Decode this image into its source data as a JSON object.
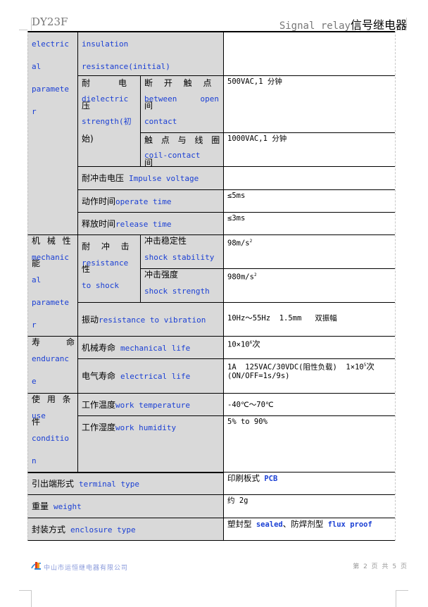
{
  "header": {
    "model": "DY23F",
    "title_en": "Signal relay",
    "title_zh": "信号继电器"
  },
  "table": {
    "electrical": {
      "group_label": [
        "electric",
        "al",
        "paramete",
        "r"
      ],
      "insulation": {
        "label": [
          "insulation",
          "resistance(initial)"
        ],
        "value": ""
      },
      "dielectric": {
        "label_zh": "耐　电　压",
        "label_en": [
          "dielectric",
          "strength(初",
          "始)"
        ],
        "open_contact": {
          "label_zh": "断 开 触 点 间",
          "label_en": [
            "between",
            "open",
            "contact"
          ],
          "value": "500VAC,1 分钟"
        },
        "coil_contact": {
          "label_zh": "触 点 与 线 圈 间",
          "label_en": "coil-contact",
          "value": "1000VAC,1 分钟"
        }
      },
      "impulse": {
        "label_zh": "耐冲击电压",
        "label_en": "Impulse voltage",
        "value": ""
      },
      "operate": {
        "label_zh": "动作时间",
        "label_en": "operate time",
        "value": "≤5ms"
      },
      "release": {
        "label_zh": "释放时间",
        "label_en": "release time",
        "value": "≤3ms"
      }
    },
    "mechanical": {
      "group_label_zh": "机 械 性 能",
      "group_label": [
        "mechanic",
        "al",
        "paramete",
        "r"
      ],
      "shock": {
        "label_zh": "耐 冲 击 性",
        "label_en": [
          "resistance",
          "to shock"
        ],
        "stability": {
          "label_zh": "冲击稳定性",
          "label_en": "shock stability",
          "value": "98m/s",
          "sup": "2"
        },
        "strength": {
          "label_zh": "冲击强度",
          "label_en": "shock strength",
          "value": "980m/s",
          "sup": "2"
        }
      },
      "vibration": {
        "label_zh": "振动",
        "label_en": "resistance to vibration",
        "value": "10Hz～55Hz  1.5mm   双振幅"
      }
    },
    "endurance": {
      "group_label_zh": [
        "寿",
        "命"
      ],
      "group_label": [
        "enduranc",
        "e"
      ],
      "mechanical_life": {
        "label_zh": "机械寿命",
        "label_en": "mechanical life",
        "value_pre": "10×10",
        "sup": "6",
        "value_post": "次"
      },
      "electrical_life": {
        "label_zh": "电气寿命",
        "label_en": "electrical life",
        "value_pre": "1A  125VAC/30VDC(阻性负载)  1×10",
        "sup": "5",
        "value_post": "次",
        "value_line2": "(ON/OFF=1s/9s)"
      }
    },
    "use_condition": {
      "group_label_zh": "使 用 条 件",
      "group_label": [
        "use",
        "conditio",
        "n"
      ],
      "temperature": {
        "label_zh": "工作温度",
        "label_en": "work temperature",
        "value": "-40℃～70℃"
      },
      "humidity": {
        "label_zh": "工作湿度",
        "label_en": "work humidity",
        "value": "5% to 90%"
      }
    },
    "terminal": {
      "label_zh": "引出端形式",
      "label_en": "terminal type",
      "value_zh": "印刷板式",
      "value_en": "PCB"
    },
    "weight": {
      "label_zh": "重量",
      "label_en": "weight",
      "value": "约 2g"
    },
    "enclosure": {
      "label_zh": "封装方式",
      "label_en": "enclosure type",
      "value_zh1": "塑封型",
      "value_en1": "sealed",
      "sep": "、",
      "value_zh2": "防焊剂型",
      "value_en2": "flux proof"
    }
  },
  "footer": {
    "company": "中山市运恒继电器有限公司",
    "page_text": "第 2 页 共 5 页",
    "logo_icon": "company-logo-icon"
  }
}
